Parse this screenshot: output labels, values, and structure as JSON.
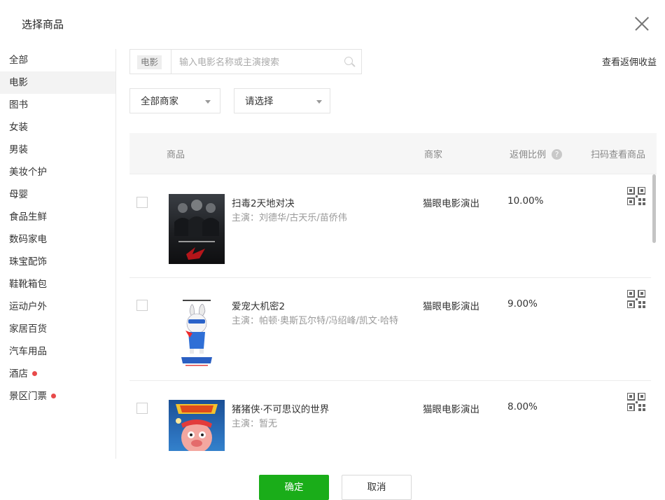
{
  "dialog": {
    "title": "选择商品"
  },
  "sidebar": {
    "items": [
      {
        "label": "全部",
        "dot": false
      },
      {
        "label": "电影",
        "dot": false,
        "active": true
      },
      {
        "label": "图书",
        "dot": false
      },
      {
        "label": "女装",
        "dot": false
      },
      {
        "label": "男装",
        "dot": false
      },
      {
        "label": "美妆个护",
        "dot": false
      },
      {
        "label": "母婴",
        "dot": false
      },
      {
        "label": "食品生鲜",
        "dot": false
      },
      {
        "label": "数码家电",
        "dot": false
      },
      {
        "label": "珠宝配饰",
        "dot": false
      },
      {
        "label": "鞋靴箱包",
        "dot": false
      },
      {
        "label": "运动户外",
        "dot": false
      },
      {
        "label": "家居百货",
        "dot": false
      },
      {
        "label": "汽车用品",
        "dot": false
      },
      {
        "label": "酒店",
        "dot": true
      },
      {
        "label": "景区门票",
        "dot": true
      }
    ]
  },
  "search": {
    "category_tag": "电影",
    "placeholder": "输入电影名称或主演搜索",
    "value": ""
  },
  "links": {
    "earnings": "查看返佣收益"
  },
  "filters": {
    "merchant_select": "全部商家",
    "other_select": "请选择"
  },
  "table": {
    "headers": {
      "product": "商品",
      "merchant": "商家",
      "ratio": "返佣比例",
      "scan": "扫码查看商品"
    },
    "help_glyph": "?",
    "rows": [
      {
        "name": "扫毒2天地对决",
        "actors": "主演：刘德华/古天乐/苗侨伟",
        "merchant": "猫眼电影演出",
        "ratio": "10.00%"
      },
      {
        "name": "爱宠大机密2",
        "actors": "主演：帕顿·奥斯瓦尔特/冯绍峰/凯文·哈特",
        "merchant": "猫眼电影演出",
        "ratio": "9.00%"
      },
      {
        "name": "猪猪侠·不可思议的世界",
        "actors": "主演：暂无",
        "merchant": "猫眼电影演出",
        "ratio": "8.00%"
      }
    ]
  },
  "buttons": {
    "confirm": "确定",
    "cancel": "取消"
  },
  "colors": {
    "primary_green": "#1aad19",
    "notify_red": "#e84a4a",
    "header_bg": "#f6f6f6"
  }
}
